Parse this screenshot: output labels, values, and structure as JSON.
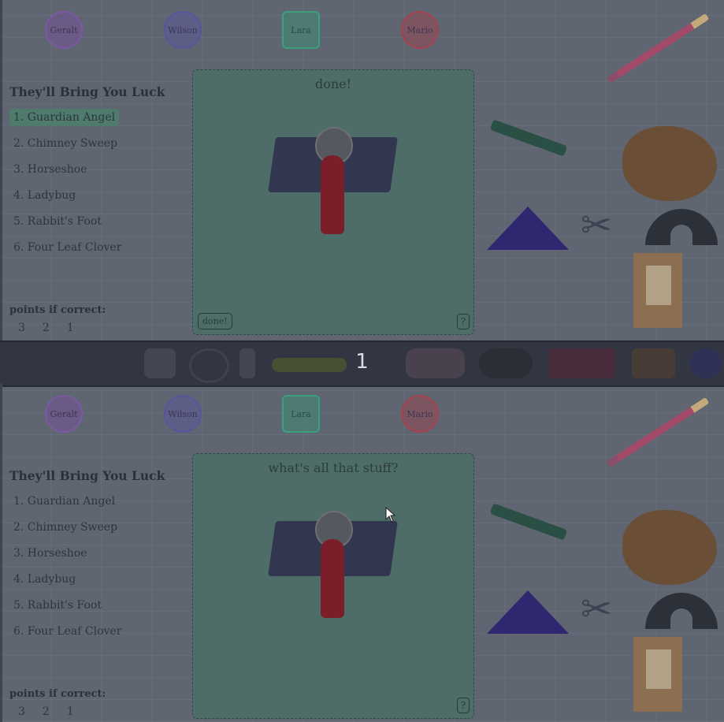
{
  "players": [
    "Geralt",
    "Wilson",
    "Lara",
    "Mario"
  ],
  "list": {
    "title": "They'll Bring You Luck",
    "items": [
      "1. Guardian Angel",
      "2. Chimney Sweep",
      "3. Horseshoe",
      "4. Ladybug",
      "5. Rabbit's Foot",
      "6. Four Leaf Clover"
    ],
    "selected_index": 0
  },
  "points": {
    "label": "points if correct:",
    "values": [
      "3",
      "2",
      "1"
    ]
  },
  "top_board": {
    "message": "done!",
    "done_label": "done!",
    "help_label": "?"
  },
  "bottom_board": {
    "message": "what's all that stuff?",
    "help_label": "?"
  },
  "divider_number": "1",
  "colors": {
    "background": "#5f6672",
    "board": "#4f6d68",
    "selected": "#4f7b6c",
    "geralt": "#7a5aa4",
    "wilson": "#55569c",
    "lara": "#3aa07e",
    "mario": "#a2434f"
  }
}
